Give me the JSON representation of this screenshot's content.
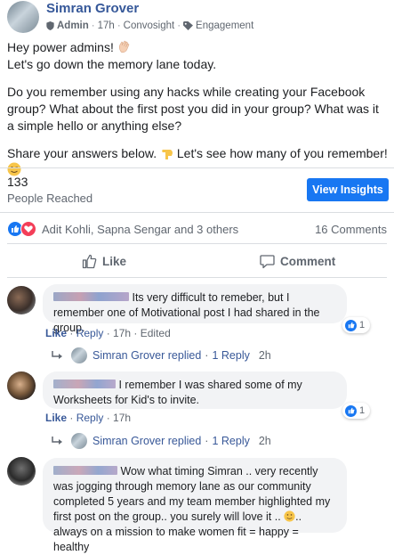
{
  "post": {
    "author": "Simran Grover",
    "role": "Admin",
    "time": "17h",
    "via": "Convosight",
    "topic": "Engagement",
    "para1_line1": "Hey power admins!",
    "para1_line2": "Let's go down the memory lane today.",
    "para2": "Do you remember using any hacks while creating your Facebook group? What about the first post you did in your group? What was it a simple hello or anything else?",
    "para3_a": "Share your answers below.",
    "para3_b": "Let's see how many of you remember!"
  },
  "stats": {
    "reach_count": "133",
    "reach_label": "People Reached",
    "insights_button": "View Insights",
    "reaction_names": "Adit Kohli, Sapna Sengar and 3 others",
    "comment_count": "16 Comments"
  },
  "actions": {
    "like": "Like",
    "comment": "Comment"
  },
  "comments": [
    {
      "text": "Its very difficult to remeber, but I remember one of Motivational post I had shared in the group.",
      "like": "Like",
      "reply": "Reply",
      "time": "17h",
      "edited": "Edited",
      "reactions": "1",
      "reply_author": "Simran Grover",
      "reply_word": "replied",
      "reply_count": "1 Reply",
      "reply_time": "2h"
    },
    {
      "text": "I remember I was shared some of my Worksheets for Kid's to invite.",
      "like": "Like",
      "reply": "Reply",
      "time": "17h",
      "reactions": "1",
      "reply_author": "Simran Grover",
      "reply_word": "replied",
      "reply_count": "1 Reply",
      "reply_time": "2h"
    },
    {
      "text_a": "Wow what timing Simran .. very recently was jogging through memory lane as our community completed 5 years and my team member highlighted my first post on the group.. you surely will love it ..",
      "text_b": ".. always on a mission to make women fit = happy = healthy"
    }
  ],
  "colors": {
    "brand_blue": "#1877f2",
    "link_blue": "#385898",
    "love_red": "#f33e58"
  },
  "icons": [
    "shield-icon",
    "globe-icon",
    "tag-icon",
    "like-icon",
    "love-icon",
    "comment-icon",
    "reply-arrow-icon"
  ]
}
